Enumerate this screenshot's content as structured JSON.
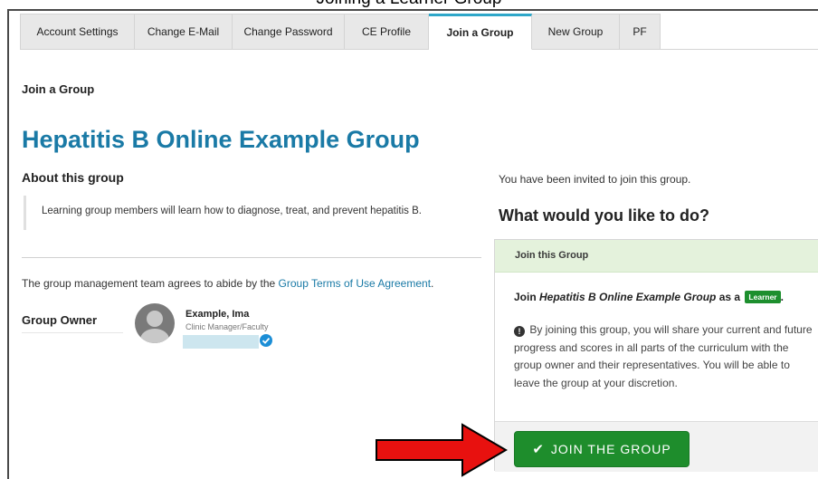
{
  "caption": "Joining a Learner Group",
  "tabs": [
    {
      "label": "Account Settings"
    },
    {
      "label": "Change E-Mail"
    },
    {
      "label": "Change Password"
    },
    {
      "label": "CE Profile"
    },
    {
      "label": "Join a Group",
      "active": true
    },
    {
      "label": "New Group"
    },
    {
      "label": "PF"
    }
  ],
  "breadcrumb": "Join a Group",
  "group": {
    "title": "Hepatitis B Online Example Group",
    "about_heading": "About this group",
    "about_text": "Learning group members will learn how to diagnose, treat, and prevent hepatitis B.",
    "terms_prefix": "The group management team agrees to abide by the ",
    "terms_link": "Group Terms of Use Agreement",
    "terms_suffix": ".",
    "owner_label": "Group Owner",
    "owner_name": "Example, Ima",
    "owner_role": "Clinic Manager/Faculty"
  },
  "invite": {
    "text": "You have been invited to join this group.",
    "question": "What would you like to do?",
    "panel_header": "Join this Group",
    "join_prefix": "Join ",
    "join_group_name": "Hepatitis B Online Example Group",
    "join_middle": " as a ",
    "role_badge": "Learner",
    "join_suffix": ".",
    "info": "By joining this group, you will share your current and future progress and scores in all parts of the curriculum with the group owner and their representatives. You will be able to leave the group at your discretion.",
    "button_label": "JOIN THE GROUP"
  },
  "colors": {
    "accent_blue": "#1a7aa6",
    "active_tab_border": "#2ea7c9",
    "panel_header_bg": "#e4f2dc",
    "button_green": "#1e8d2c",
    "arrow_red": "#e8110f"
  },
  "icons": [
    "avatar-placeholder-icon",
    "verified-check-icon",
    "info-circle-icon",
    "checkmark-icon",
    "red-arrow-icon"
  ]
}
